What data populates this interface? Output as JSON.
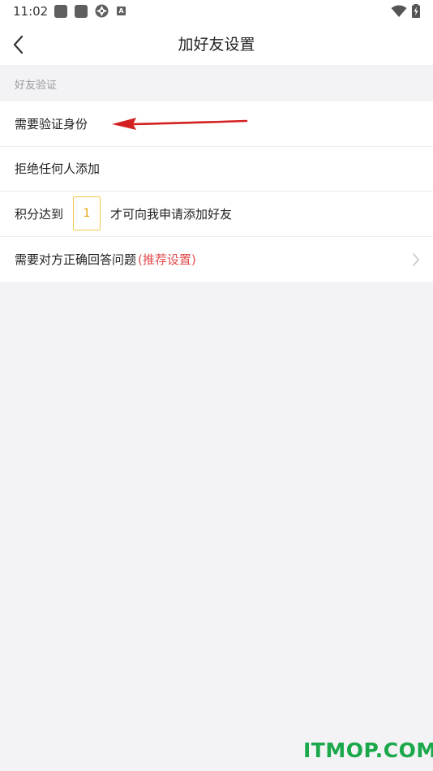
{
  "status_bar": {
    "time": "11:02",
    "notification_letter": "A"
  },
  "header": {
    "title": "加好友设置"
  },
  "section": {
    "title": "好友验证"
  },
  "options": {
    "verify_identity": "需要验证身份",
    "reject_all": "拒绝任何人添加",
    "score_prefix": "积分达到",
    "score_value": "1",
    "score_suffix": "才可向我申请添加好友",
    "answer_question": "需要对方正确回答问题",
    "answer_question_tag": "(推荐设置)"
  },
  "watermark": "ITMOP.COM",
  "colors": {
    "accent_red": "#e34b4b",
    "score_border": "#f2c94c",
    "watermark_green": "#1aa84a",
    "background": "#f3f3f5"
  }
}
